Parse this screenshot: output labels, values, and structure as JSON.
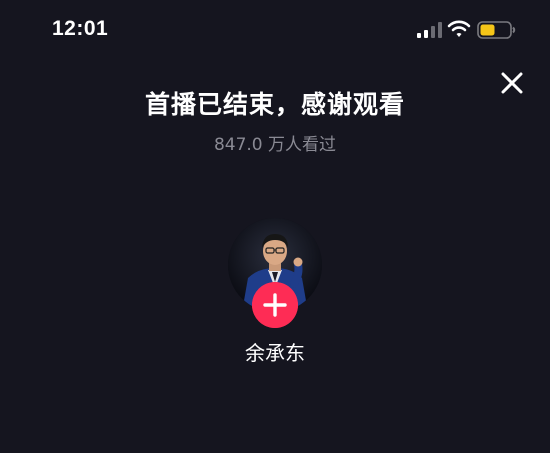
{
  "status_bar": {
    "time": "12:01",
    "icons": [
      "signal-icon",
      "wifi-icon",
      "battery-icon"
    ],
    "battery_color": "#f5c518"
  },
  "header": {
    "close_icon": "close-icon"
  },
  "live_end": {
    "title": "首播已结束，感谢观看",
    "viewers": "847.0 万人看过"
  },
  "streamer": {
    "name": "余承东",
    "follow_icon": "plus-icon"
  },
  "colors": {
    "background": "#15151f",
    "accent": "#fe2c55",
    "muted_text": "#8a8a94"
  }
}
